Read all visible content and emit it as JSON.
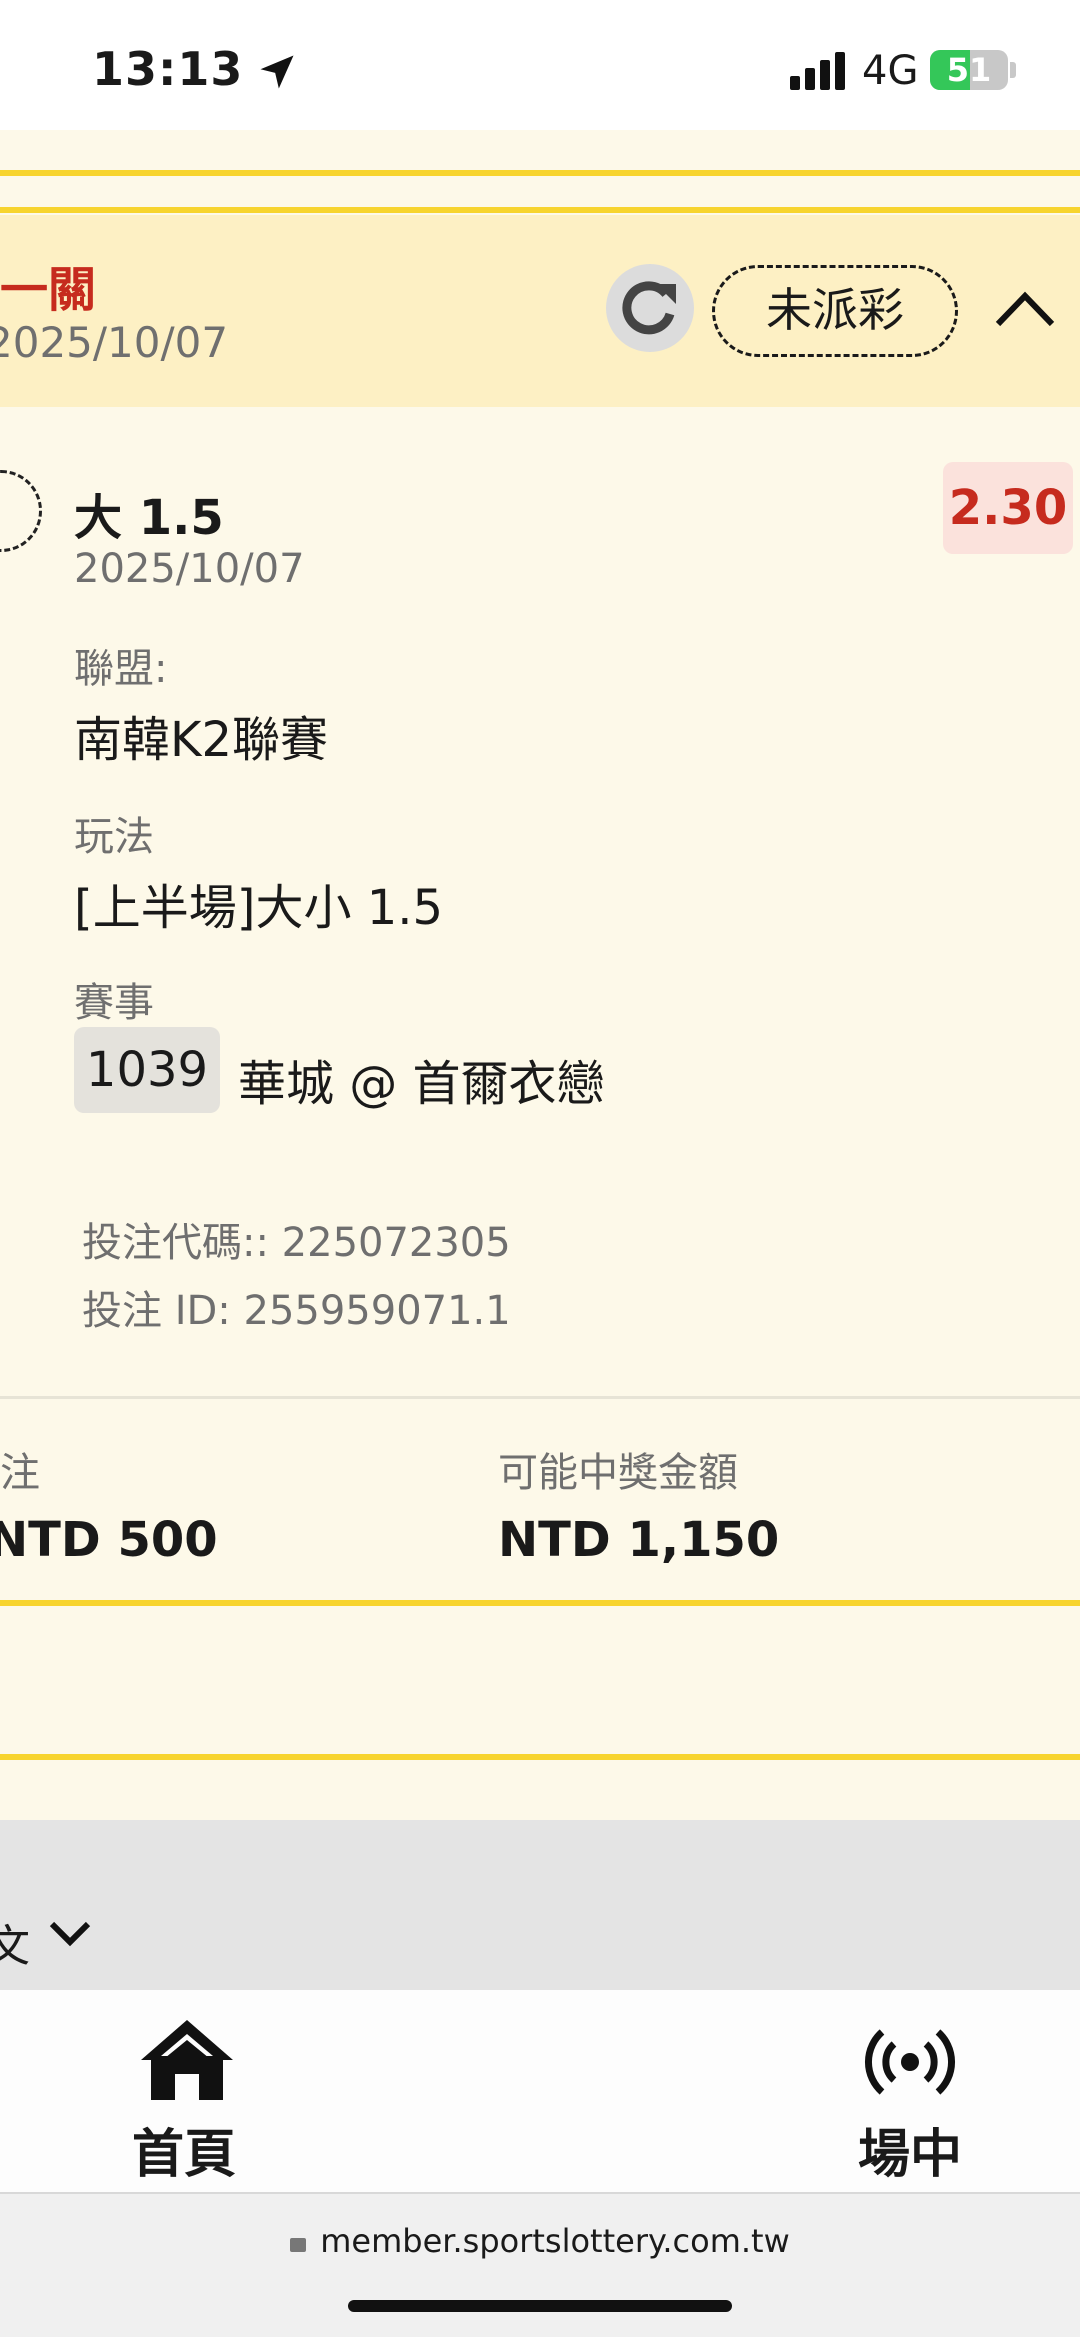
{
  "status_bar": {
    "time": "13:13",
    "network": "4G",
    "battery": "51",
    "battery_level": 0.51
  },
  "ticket": {
    "title": "一關",
    "date": "2025/10/07",
    "status": "未派彩",
    "selection": {
      "name": "大 1.5",
      "date": "2025/10/07",
      "odds": "2.30",
      "league_label": "聯盟:",
      "league_value": "南韓K2聯賽",
      "play_label": "玩法",
      "play_value": "[上半場]大小 1.5",
      "match_label": "賽事",
      "match_number": "1039",
      "match_name": "華城 @ 首爾衣戀",
      "bet_code": "投注代碼:: 225072305",
      "bet_id": "投注 ID: 255959071.1"
    },
    "stake_label": "投注",
    "stake_value": "NTD 500",
    "payout_label": "可能中獎金額",
    "payout_value": "NTD 1,150"
  },
  "language": {
    "label": "文"
  },
  "bottom_nav": {
    "home": "首頁",
    "live": "場中"
  },
  "browser": {
    "url": "member.sportslottery.com.tw"
  },
  "colors": {
    "accent_yellow": "#f7d42e",
    "header_bg": "#fdf0c4",
    "title_red": "#c62b1e",
    "odds_bg": "#fbe2dc"
  },
  "icons": [
    "location-arrow-icon",
    "signal-icon",
    "battery-icon",
    "refresh-icon",
    "chevron-up-icon",
    "chevron-down-icon",
    "home-icon",
    "broadcast-icon",
    "lock-icon"
  ]
}
